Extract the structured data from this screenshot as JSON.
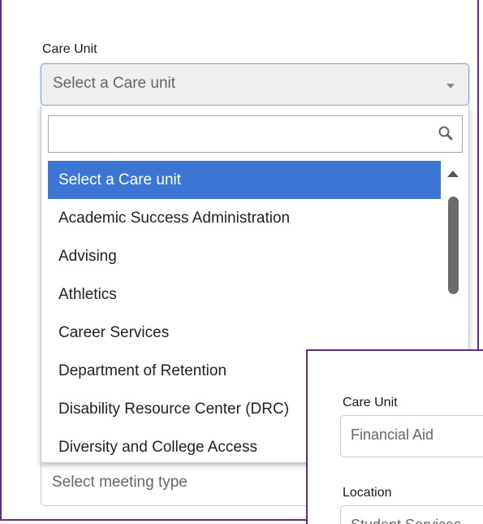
{
  "care_unit_label": "Care Unit",
  "care_unit_select": {
    "value": "Select a Care unit",
    "search_placeholder": ""
  },
  "options": [
    "Select a Care unit",
    "Academic Success Administration",
    "Advising",
    "Athletics",
    "Career Services",
    "Department of Retention",
    "Disability Resource Center (DRC)",
    "Diversity and College Access"
  ],
  "meeting_type": {
    "placeholder": "Select meeting type"
  },
  "overlay": {
    "care_unit_label": "Care Unit",
    "care_unit_value": "Financial Aid",
    "location_label": "Location",
    "location_value": "Student Services"
  },
  "colors": {
    "selected": "#3b76d5",
    "frame": "#5b2d83"
  },
  "icons": {
    "search": "search-icon",
    "dropdown": "chevron-down-icon"
  }
}
